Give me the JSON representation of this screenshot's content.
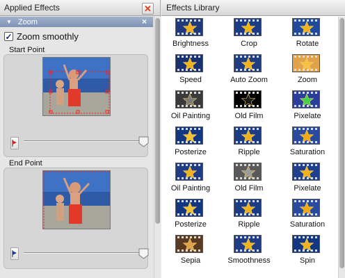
{
  "left_panel": {
    "title": "Applied Effects",
    "effect": {
      "name": "Zoom"
    },
    "zoom_smoothly": {
      "label": "Zoom smoothly",
      "checked": true
    },
    "start_point": {
      "label": "Start Point"
    },
    "end_point": {
      "label": "End Point"
    }
  },
  "right_panel": {
    "title": "Effects Library",
    "effects": [
      {
        "name": "Brightness",
        "star": "#f0b020",
        "bg": "#1e3a7a"
      },
      {
        "name": "Crop",
        "star": "#f2b315",
        "bg": "#1c3c86"
      },
      {
        "name": "Rotate",
        "star": "#f1b21c",
        "bg": "#224a9a"
      },
      {
        "name": "Speed",
        "star": "#f1b21c",
        "bg": "#1a3170"
      },
      {
        "name": "Auto Zoom",
        "star": "#f3b31a",
        "bg": "#1f3d80"
      },
      {
        "name": "Zoom",
        "star": "#f6c040",
        "bg": "#e0a24a"
      },
      {
        "name": "Oil Painting",
        "star": "#7a7a7a",
        "bg": "#3b3b3b"
      },
      {
        "name": "Old Film",
        "star": "#1a1a1a",
        "bg": "#000000"
      },
      {
        "name": "Pixelate",
        "star": "#44d24a",
        "bg": "#2b3e9a"
      },
      {
        "name": "Posterize",
        "star": "#f3c132",
        "bg": "#12367f"
      },
      {
        "name": "Ripple",
        "star": "#f0b21c",
        "bg": "#1c3c86"
      },
      {
        "name": "Saturation",
        "star": "#f4a914",
        "bg": "#2a4b9d"
      },
      {
        "name": "Oil Painting",
        "star": "#f1b21c",
        "bg": "#1f3c84"
      },
      {
        "name": "Old Film",
        "star": "#9a9a9a",
        "bg": "#5a5a5a"
      },
      {
        "name": "Pixelate",
        "star": "#f1b21c",
        "bg": "#203f8c"
      },
      {
        "name": "Posterize",
        "star": "#f3c132",
        "bg": "#12367f"
      },
      {
        "name": "Ripple",
        "star": "#f0b21c",
        "bg": "#1c3c86"
      },
      {
        "name": "Saturation",
        "star": "#f4a914",
        "bg": "#2a4b9d"
      },
      {
        "name": "Sepia",
        "star": "#e0a24a",
        "bg": "#5a3b21"
      },
      {
        "name": "Smoothness",
        "star": "#f1b21c",
        "bg": "#1f3c84"
      },
      {
        "name": "Spin",
        "star": "#f1b21c",
        "bg": "#12367f"
      }
    ]
  },
  "icons": {
    "close": "close-icon",
    "collapse": "disclosure-triangle-icon",
    "remove": "remove-effect-icon",
    "checkbox": "checkmark-icon",
    "flag_start": "start-flag-icon",
    "flag_end": "end-flag-icon"
  }
}
